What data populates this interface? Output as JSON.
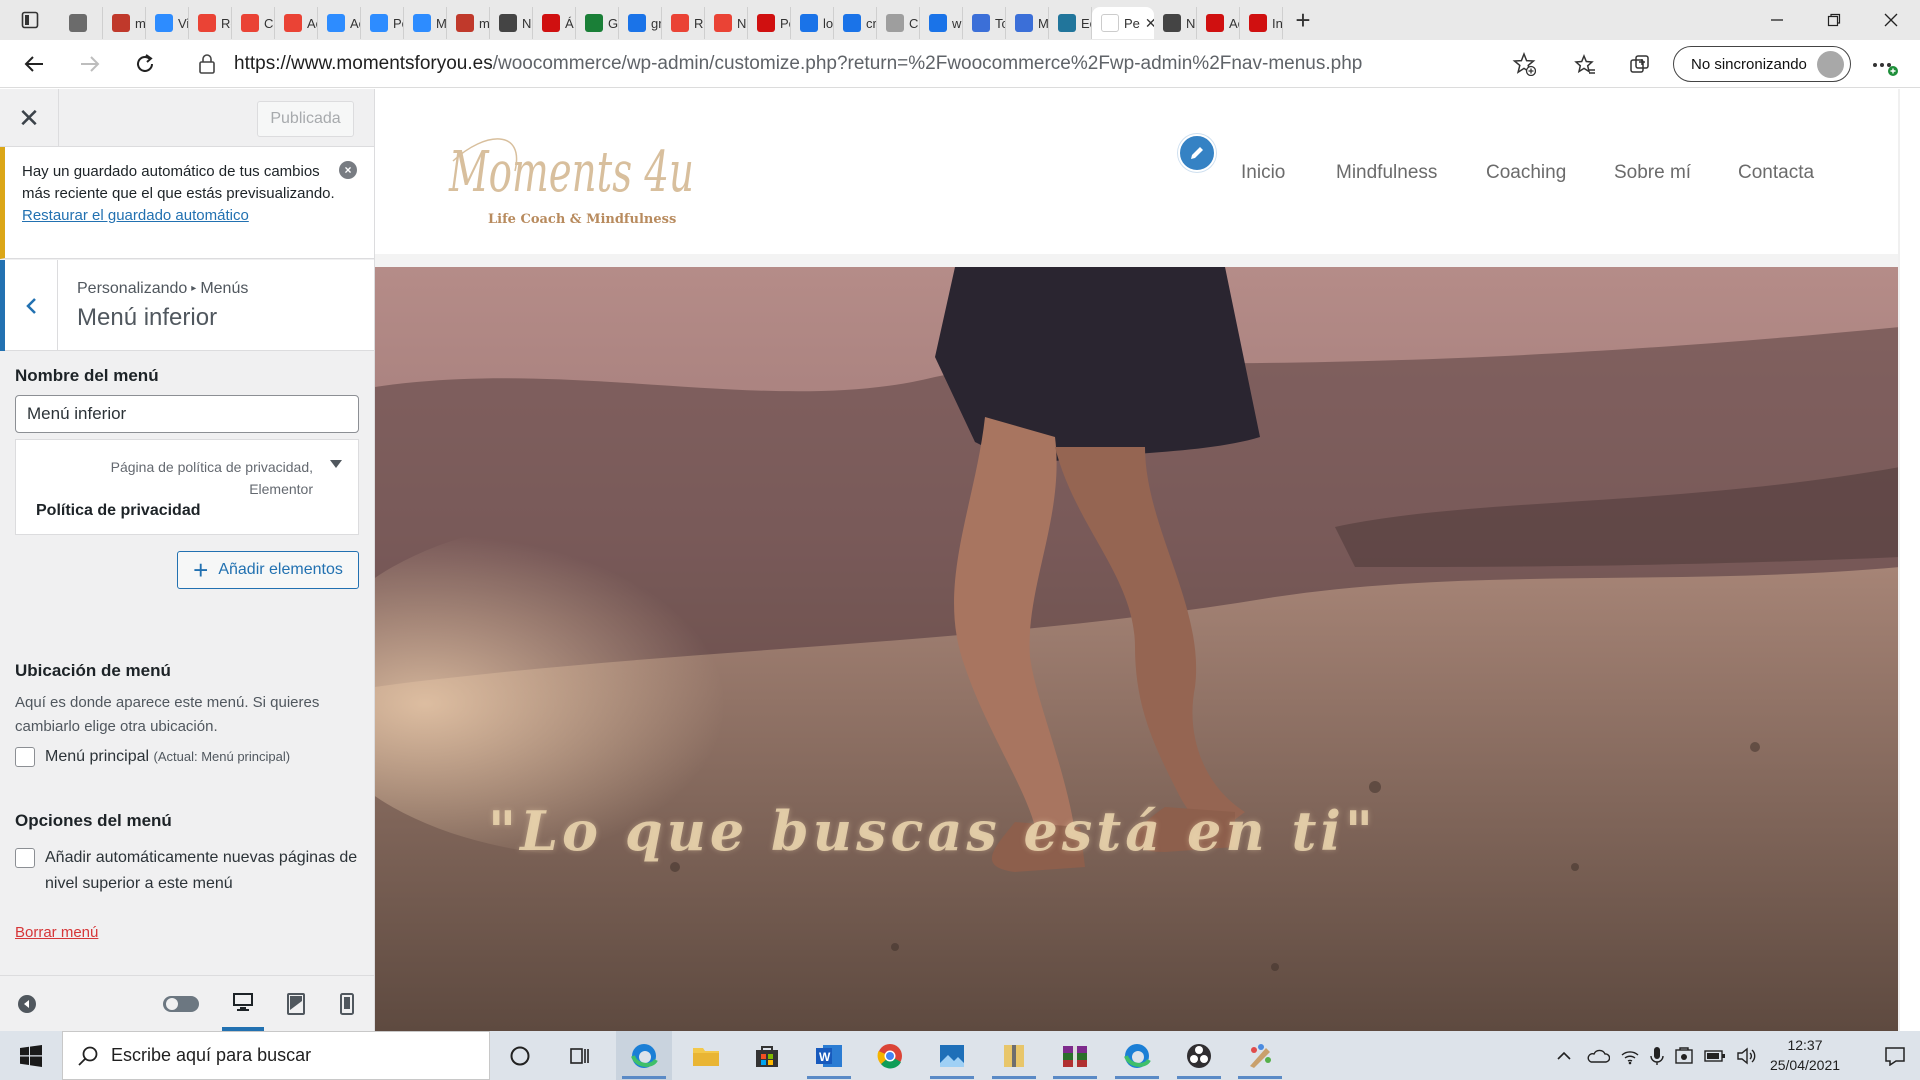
{
  "browser": {
    "tabs": [
      {
        "label": "",
        "icon": "outlook-icon",
        "color": "#6b6b6b"
      },
      {
        "label": "m",
        "icon": "pdf-icon",
        "color": "#c0392b"
      },
      {
        "label": "Vi",
        "icon": "zoom-icon",
        "color": "#2d8cff"
      },
      {
        "label": "Re",
        "icon": "gmail-icon",
        "color": "#ea4335"
      },
      {
        "label": "Cc",
        "icon": "gmail-icon",
        "color": "#ea4335"
      },
      {
        "label": "Ac",
        "icon": "gmail-icon",
        "color": "#ea4335"
      },
      {
        "label": "Ac",
        "icon": "zoom-icon",
        "color": "#2d8cff"
      },
      {
        "label": "Pc",
        "icon": "zoom-icon",
        "color": "#2d8cff"
      },
      {
        "label": "M",
        "icon": "zoom-icon",
        "color": "#2d8cff"
      },
      {
        "label": "m",
        "icon": "pdf-icon",
        "color": "#c0392b"
      },
      {
        "label": "N",
        "icon": "tab-icon",
        "color": "#444444"
      },
      {
        "label": "Á",
        "icon": "wordreference-icon",
        "color": "#d01010"
      },
      {
        "label": "Gr",
        "icon": "wp-green-icon",
        "color": "#1a7f37"
      },
      {
        "label": "gr",
        "icon": "bing-icon",
        "color": "#1a73e8"
      },
      {
        "label": "Re",
        "icon": "gmail-icon",
        "color": "#ea4335"
      },
      {
        "label": "N",
        "icon": "gmail-icon",
        "color": "#ea4335"
      },
      {
        "label": "Pc",
        "icon": "wordreference-icon",
        "color": "#d01010"
      },
      {
        "label": "lo",
        "icon": "bing-icon",
        "color": "#1a73e8"
      },
      {
        "label": "cr",
        "icon": "bing-icon",
        "color": "#1a73e8"
      },
      {
        "label": "Cl",
        "icon": "page-icon",
        "color": "#9e9e9e"
      },
      {
        "label": "wi",
        "icon": "bing-icon",
        "color": "#1a73e8"
      },
      {
        "label": "Tc",
        "icon": "cortana-icon",
        "color": "#3b6fd8"
      },
      {
        "label": "M",
        "icon": "cortana-icon",
        "color": "#3b6fd8"
      },
      {
        "label": "Ec",
        "icon": "wordpress-icon",
        "color": "#21759b"
      }
    ],
    "active_tab": {
      "label": "Pe",
      "close": "✕"
    },
    "tabs_after": [
      {
        "label": "N",
        "icon": "tab-icon",
        "color": "#444444"
      },
      {
        "label": "Ac",
        "icon": "wordreference-icon",
        "color": "#d01010"
      },
      {
        "label": "In",
        "icon": "wordreference-icon",
        "color": "#d01010"
      }
    ],
    "url_host": "https://www.momentsforyou.es",
    "url_path": "/woocommerce/wp-admin/customize.php?return=%2Fwoocommerce%2Fwp-admin%2Fnav-menus.php",
    "sync_label": "No sincronizando"
  },
  "customizer": {
    "publish_label": "Publicada",
    "notice": {
      "text": "Hay un guardado automático de tus cambios más reciente que el que estás previsualizando. ",
      "link": "Restaurar el guardado automático"
    },
    "breadcrumb": {
      "root": "Personalizando",
      "sep": "▸",
      "current": "Menús"
    },
    "section_title": "Menú inferior",
    "menu_name_label": "Nombre del menú",
    "menu_name_value": "Menú inferior",
    "menu_item": {
      "type": "Página de política de privacidad, Elementor",
      "title": "Política de privacidad"
    },
    "add_items_label": "Añadir elementos",
    "location": {
      "heading": "Ubicación de menú",
      "description": "Aquí es donde aparece este menú. Si quieres cambiarlo elige otra ubicación.",
      "option_label": "Menú principal",
      "option_note": "(Actual: Menú principal)"
    },
    "options": {
      "heading": "Opciones del menú",
      "auto_add_label": "Añadir automáticamente nuevas páginas de nivel superior a este menú"
    },
    "delete_label": "Borrar menú"
  },
  "site": {
    "logo_text": "Moments 4u",
    "tagline": "Life Coach & Mindfulness",
    "nav": [
      "Inicio",
      "Mindfulness",
      "Coaching",
      "Sobre mí",
      "Contacta"
    ],
    "quote": "\"Lo que buscas está en ti\""
  },
  "taskbar": {
    "search_placeholder": "Escribe aquí para buscar",
    "time": "12:37",
    "date": "25/04/2021"
  }
}
